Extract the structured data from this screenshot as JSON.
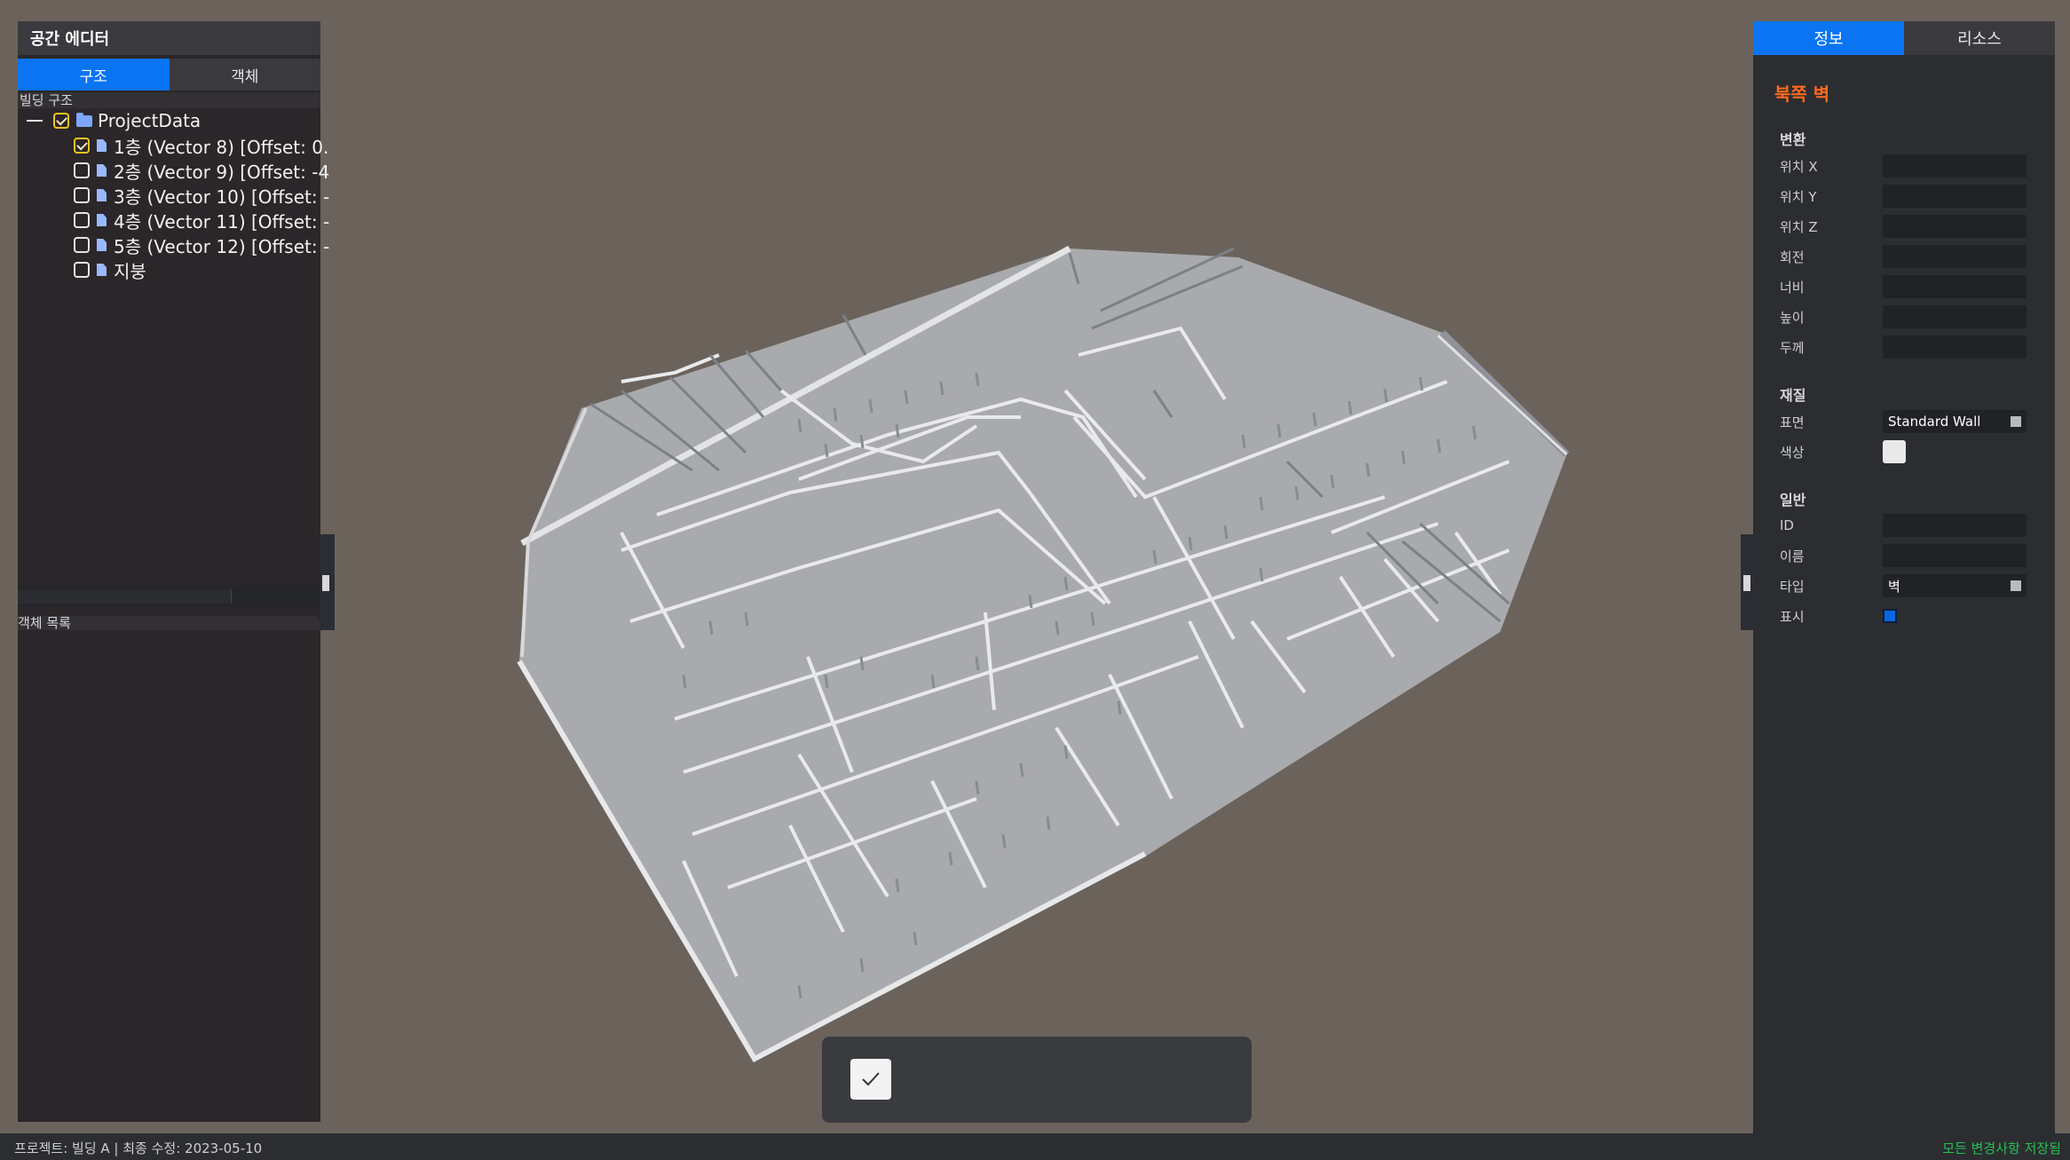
{
  "left_panel": {
    "title": "공간 에디터",
    "tabs": [
      {
        "label": "구조"
      },
      {
        "label": "객체"
      }
    ],
    "structure_label": "빌딩 구조",
    "tree": {
      "root": {
        "label": "ProjectData",
        "checked": true
      },
      "floors": [
        {
          "label": "1층 (Vector 8) [Offset: 0.",
          "checked": true
        },
        {
          "label": "2층 (Vector 9) [Offset: -4",
          "checked": false
        },
        {
          "label": "3층 (Vector 10) [Offset: -",
          "checked": false
        },
        {
          "label": "4층 (Vector 11) [Offset: -",
          "checked": false
        },
        {
          "label": "5층 (Vector 12) [Offset: -",
          "checked": false
        },
        {
          "label": "지붕",
          "checked": false
        }
      ]
    },
    "object_list_label": "객체 목록"
  },
  "right_panel": {
    "tabs": [
      {
        "label": "정보"
      },
      {
        "label": "리소스"
      }
    ],
    "selected_title": "북쪽 벽",
    "sections": {
      "transform": {
        "title": "변환",
        "fields": [
          {
            "label": "위치 X",
            "value": ""
          },
          {
            "label": "위치 Y",
            "value": ""
          },
          {
            "label": "위치 Z",
            "value": ""
          },
          {
            "label": "회전",
            "value": ""
          },
          {
            "label": "너비",
            "value": ""
          },
          {
            "label": "높이",
            "value": ""
          },
          {
            "label": "두께",
            "value": ""
          }
        ]
      },
      "material": {
        "title": "재질",
        "surface_label": "표면",
        "surface_value": "Standard Wall",
        "color_label": "색상",
        "color_value": "#e9e9ea"
      },
      "general": {
        "title": "일반",
        "id_label": "ID",
        "id_value": "",
        "name_label": "이름",
        "name_value": "",
        "type_label": "타입",
        "type_value": "벽",
        "visible_label": "표시",
        "visible": true
      }
    }
  },
  "status_bar": {
    "left_text": "프로젝트: 빌딩 A  |  최종 수정: 2023-05-10",
    "right_text": "모든 변경사항 저장됨"
  },
  "bottom_toolbar": {
    "confirm_icon": "check-icon"
  },
  "colors": {
    "accent": "#0a74f3",
    "title_orange": "#ff6a1f",
    "saved_green": "#25c254",
    "viewport_bg": "#6b635b"
  }
}
